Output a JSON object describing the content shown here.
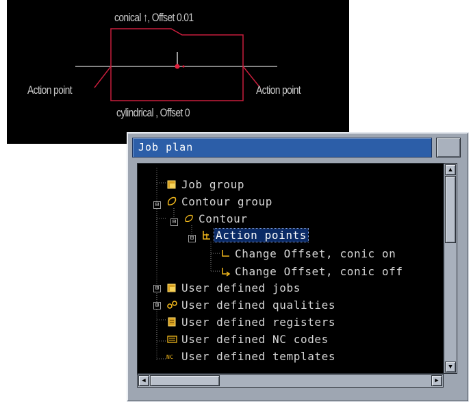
{
  "cad_preview": {
    "label_top": "conical ↑, Offset 0.01",
    "label_bottom": "cylindrical , Offset 0",
    "label_left": "Action point",
    "label_right": "Action point",
    "colors": {
      "background": "#000000",
      "contour": "#c81e3c",
      "axis": "#b0b0b0",
      "text": "#c8c8c8"
    }
  },
  "window": {
    "title": "Job plan",
    "colors": {
      "titlebar": "#2c5ea8",
      "frame": "#9ea6b2",
      "tree_bg": "#000000",
      "tree_text": "#d6d6d6",
      "selection": "#0a2a66"
    }
  },
  "tree": {
    "items": [
      {
        "label": "Job group",
        "icon": "job-group-icon",
        "expander": ""
      },
      {
        "label": "Contour group",
        "icon": "contour-group-icon",
        "expander": "⊟"
      },
      {
        "label": "Contour",
        "icon": "contour-icon",
        "expander": "⊟"
      },
      {
        "label": "Action points",
        "icon": "action-points-icon",
        "expander": "⊟",
        "selected": true
      },
      {
        "label": "Change Offset, conic on",
        "icon": "action-point-on-icon",
        "expander": ""
      },
      {
        "label": "Change Offset, conic off",
        "icon": "action-point-off-icon",
        "expander": ""
      },
      {
        "label": "User defined jobs",
        "icon": "user-jobs-icon",
        "expander": "⊞"
      },
      {
        "label": "User defined qualities",
        "icon": "qualities-icon",
        "expander": "⊞"
      },
      {
        "label": "User defined registers",
        "icon": "registers-icon",
        "expander": ""
      },
      {
        "label": "User defined NC codes",
        "icon": "nc-codes-icon",
        "expander": ""
      },
      {
        "label": "User defined templates",
        "icon": "templates-icon",
        "expander": ""
      }
    ]
  }
}
